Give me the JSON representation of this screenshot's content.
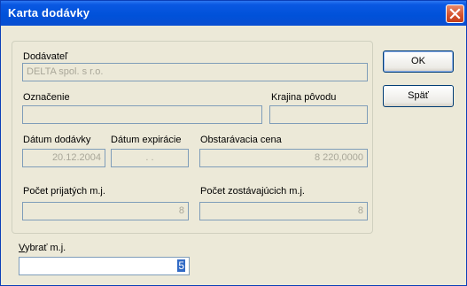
{
  "window": {
    "title": "Karta dodávky"
  },
  "labels": {
    "supplier": "Dodávateľ",
    "designation": "Označenie",
    "origin_country": "Krajina pôvodu",
    "delivery_date": "Dátum dodávky",
    "expiry_date": "Dátum expirácie",
    "purchase_price": "Obstarávacia cena",
    "received_units": "Počet prijatých m.j.",
    "remaining_units": "Počet zostávajúcich m.j.",
    "select_units_hotkey": "V",
    "select_units_rest": "ybrať  m.j."
  },
  "fields": {
    "supplier": "DELTA spol. s r.o.",
    "designation": "",
    "origin_country": "",
    "delivery_date": "20.12.2004",
    "expiry_date": " .  .",
    "purchase_price": "8 220,0000",
    "received_units": "8",
    "remaining_units": "8",
    "select_units_value": "5"
  },
  "buttons": {
    "ok": "OK",
    "back": "Späť"
  }
}
